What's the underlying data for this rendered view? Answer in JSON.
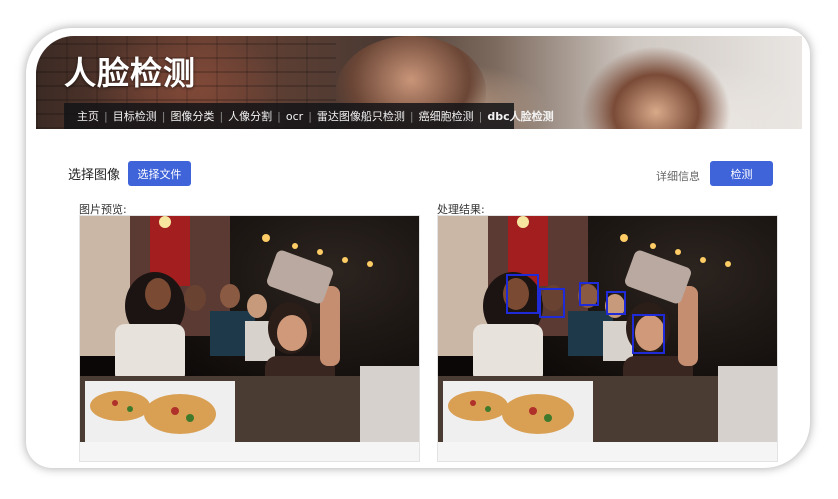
{
  "header": {
    "title": "人脸检测",
    "nav": [
      {
        "label": "主页",
        "active": false
      },
      {
        "label": "目标检测",
        "active": false
      },
      {
        "label": "图像分类",
        "active": false
      },
      {
        "label": "人像分割",
        "active": false
      },
      {
        "label": "ocr",
        "active": false
      },
      {
        "label": "雷达图像船只检测",
        "active": false
      },
      {
        "label": "癌细胞检测",
        "active": false
      },
      {
        "label": "dbc人脸检测",
        "active": true
      }
    ],
    "separator": "|"
  },
  "toolbar": {
    "select_image_label": "选择图像",
    "choose_file_button": "选择文件",
    "detail_link": "详细信息",
    "detect_button": "检测"
  },
  "panels": {
    "preview_label": "图片预览:",
    "result_label": "处理结果:"
  },
  "detections": {
    "box_color": "#1f2bd8",
    "count": 5
  },
  "colors": {
    "accent": "#3f63d9"
  }
}
